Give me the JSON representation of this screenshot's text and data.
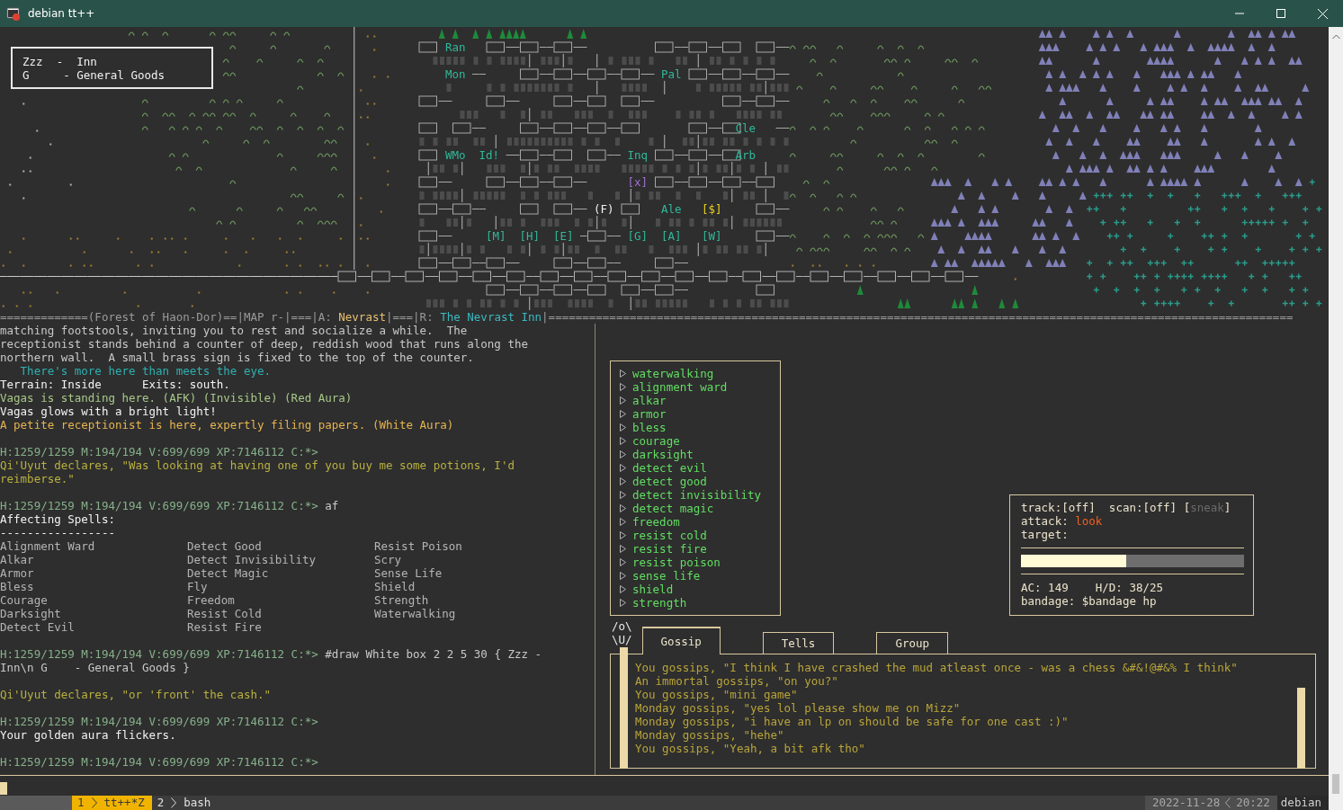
{
  "window": {
    "title": "debian tt++"
  },
  "map": {
    "legend": [
      "Zzz  -  Inn",
      "G     - General Goods"
    ],
    "labels": [
      {
        "text": "Ran",
        "color": "#2fb89a"
      },
      {
        "text": "Mon",
        "color": "#2fb89a"
      },
      {
        "text": "Pal",
        "color": "#2fb89a"
      },
      {
        "text": "Cle",
        "color": "#2fb89a"
      },
      {
        "text": "WMo",
        "color": "#2fb89a"
      },
      {
        "text": "Id!",
        "color": "#2fb89a"
      },
      {
        "text": "Inq",
        "color": "#2fb89a"
      },
      {
        "text": "Arb",
        "color": "#2fb89a"
      },
      {
        "text": "[x]",
        "color": "#a070d0"
      },
      {
        "text": "(F)",
        "color": "#f0f0f0"
      },
      {
        "text": "Ale",
        "color": "#2fb89a"
      },
      {
        "text": "[$]",
        "color": "#e8d020"
      },
      {
        "text": "[M]",
        "color": "#2fb89a"
      },
      {
        "text": "[H]",
        "color": "#2fb89a"
      },
      {
        "text": "[E]",
        "color": "#2fb89a"
      },
      {
        "text": "[G]",
        "color": "#2fb89a"
      },
      {
        "text": "[A]",
        "color": "#2fb89a"
      },
      {
        "text": "[W]",
        "color": "#2fb89a"
      }
    ]
  },
  "separator": [
    {
      "text": "=============(Forest of Haon-Dor)==|MAP r-|===|A: ",
      "kind": "plain"
    },
    {
      "text": "Nevrast",
      "kind": "area"
    },
    {
      "text": "|===|R: ",
      "kind": "plain"
    },
    {
      "text": "The Nevrast Inn",
      "kind": "room"
    },
    {
      "text": "|==============================================================================================================",
      "kind": "plain"
    }
  ],
  "output": [
    {
      "kind": "desc",
      "text": "matching footstools, inviting you to rest and socialize a while.  The"
    },
    {
      "kind": "desc",
      "text": "receptionist stands behind a counter of deep, reddish wood that runs along the"
    },
    {
      "kind": "desc",
      "text": "northern wall.  A small brass sign is fixed to the top of the counter."
    },
    {
      "kind": "hint",
      "text": "   There's more here than meets the eye."
    },
    {
      "kind": "white",
      "text": "Terrain: Inside      Exits: south."
    },
    {
      "kind": "player",
      "text": "Vagas is standing here. (AFK) (Invisible) (Red Aura)"
    },
    {
      "kind": "white",
      "text": "Vagas glows with a bright light!"
    },
    {
      "kind": "npc",
      "text": "A petite receptionist is here, expertly filing papers. (White Aura)"
    },
    {
      "kind": "blank"
    },
    {
      "kind": "prompt",
      "text": "H:1259/1259 M:194/194 V:699/699 XP:7146112 C:*>"
    },
    {
      "kind": "say",
      "text": "Qi'Uyut declares, \"Was looking at having one of you buy me some potions, I'd"
    },
    {
      "kind": "say",
      "text": "reimberse.\""
    },
    {
      "kind": "blank"
    },
    {
      "kind": "prompt",
      "text": "H:1259/1259 M:194/194 V:699/699 XP:7146112 C:*>",
      "command": "af"
    },
    {
      "kind": "white",
      "text": "Affecting Spells:"
    },
    {
      "kind": "white",
      "text": "-----------------"
    },
    {
      "kind": "table",
      "rows": [
        [
          "Alignment Ward",
          "Detect Good",
          "Resist Poison"
        ],
        [
          "Alkar",
          "Detect Invisibility",
          "Scry"
        ],
        [
          "Armor",
          "Detect Magic",
          "Sense Life"
        ],
        [
          "Bless",
          "Fly",
          "Shield"
        ],
        [
          "Courage",
          "Freedom",
          "Strength"
        ],
        [
          "Darksight",
          "Resist Cold",
          "Waterwalking"
        ],
        [
          "Detect Evil",
          "Resist Fire"
        ]
      ]
    },
    {
      "kind": "blank"
    },
    {
      "kind": "prompt",
      "text": "H:1259/1259 M:194/194 V:699/699 XP:7146112 C:*>",
      "command": "#draw White box 2 2 5 30 { Zzz -"
    },
    {
      "kind": "desc",
      "text": "Inn\\n G    - General Goods }"
    },
    {
      "kind": "blank"
    },
    {
      "kind": "say",
      "text": "Qi'Uyut declares, \"or 'front' the cash.\""
    },
    {
      "kind": "blank"
    },
    {
      "kind": "prompt",
      "text": "H:1259/1259 M:194/194 V:699/699 XP:7146112 C:*>"
    },
    {
      "kind": "white",
      "text": "Your golden aura flickers."
    },
    {
      "kind": "blank"
    },
    {
      "kind": "prompt",
      "text": "H:1259/1259 M:194/194 V:699/699 XP:7146112 C:*>"
    }
  ],
  "spells": [
    "waterwalking",
    "alignment ward",
    "alkar",
    "armor",
    "bless",
    "courage",
    "darksight",
    "detect evil",
    "detect good",
    "detect invisibility",
    "detect magic",
    "freedom",
    "resist cold",
    "resist fire",
    "resist poison",
    "sense life",
    "shield",
    "strength"
  ],
  "status": {
    "track": "track:[off]",
    "scan": "scan:[off]",
    "sneak": {
      "open": "[",
      "label": "sneak",
      "close": "]",
      "on": false
    },
    "attack_label": "attack:",
    "attack_value": "look",
    "target_label": "target:",
    "level": 0.47,
    "ac": "AC: 149    H/D: 38/25",
    "bandage": "bandage: $bandage hp"
  },
  "chat": {
    "logo": [
      "/o\\",
      "\\U/"
    ],
    "tabs": [
      {
        "label": "Gossip",
        "selected": true
      },
      {
        "label": "Tells",
        "selected": false
      },
      {
        "label": "Group",
        "selected": false
      }
    ],
    "lines": [
      "You gossips, \"I think I have crashed the mud atleast once - was a chess &#&!@#&% I think\"",
      "An immortal gossips, \"on you?\"",
      "You gossips, \"mini game\"",
      "Monday gossips, \"yes lol please show me on Mizz\"",
      "Monday gossips, \"i have an lp on should be safe for one cast :)\"",
      "Monday gossips, \"hehe\"",
      "You gossips, \"Yeah, a bit afk tho\""
    ]
  },
  "status_bar": {
    "windows": [
      {
        "index": "1",
        "name": "tt++*Z",
        "selected": true
      },
      {
        "index": "2",
        "name": "bash",
        "selected": false
      }
    ],
    "date": "2022-11-28",
    "time": "20:22",
    "host": "debian"
  }
}
